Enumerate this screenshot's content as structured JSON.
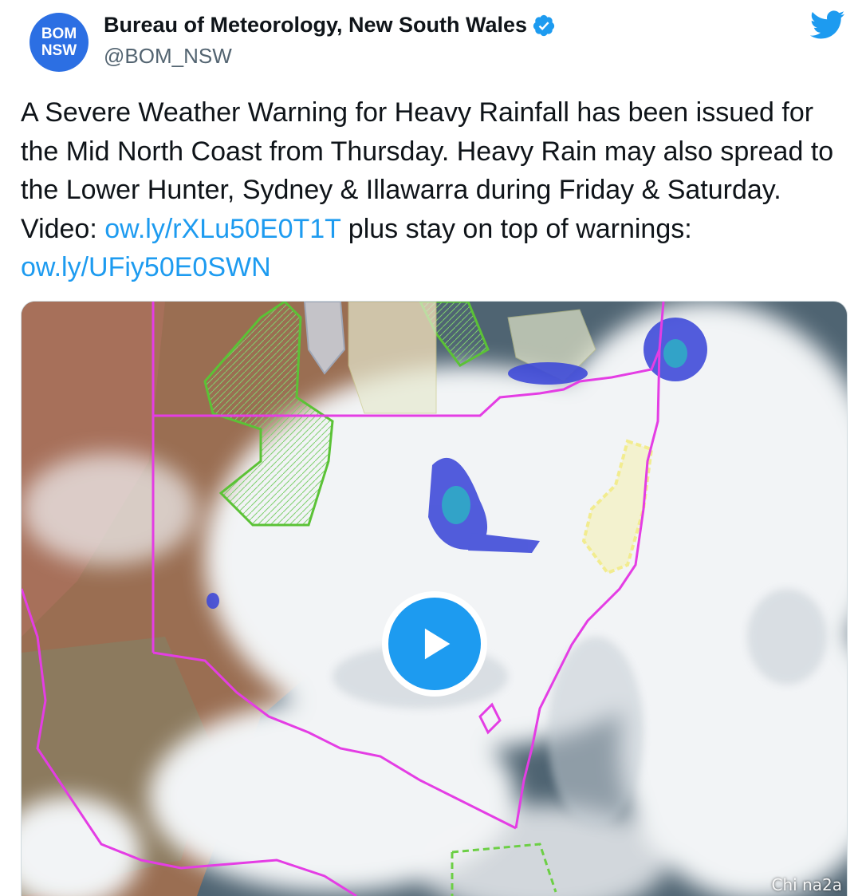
{
  "account": {
    "avatar_line1": "BOM",
    "avatar_line2": "NSW",
    "display_name": "Bureau of Meteorology, New South Wales",
    "handle": "@BOM_NSW",
    "verified": true
  },
  "tweet": {
    "text_part1": "A Severe Weather Warning for Heavy Rainfall has been issued for the Mid North Coast from Thursday. Heavy Rain may also spread to the Lower Hunter, Sydney & Illawarra during Friday & Saturday. Video: ",
    "link1": "ow.ly/rXLu50E0T1T",
    "text_part2": " plus stay on top of warnings: ",
    "link2": "ow.ly/UFiy50E0SWN"
  },
  "media": {
    "type": "video",
    "watermark": "Chi na2a"
  },
  "icons": {
    "brand": "twitter-bird-icon",
    "verified": "verified-badge-icon",
    "play": "play-icon"
  },
  "colors": {
    "avatar_bg": "#2c6fe3",
    "link": "#1d9bf0",
    "verified": "#1d9bf0",
    "play_button": "#1d9bf0",
    "twitter_brand": "#1d9bf0"
  }
}
